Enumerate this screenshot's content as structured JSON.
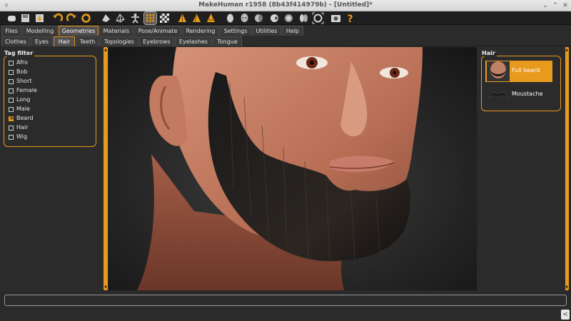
{
  "window": {
    "title": "MakeHuman r1958 (8b43f414979b) - [Untitled]*",
    "menu_glyph": "▿",
    "min_glyph": "⌄",
    "max_glyph": "⌃",
    "close_glyph": "✕"
  },
  "toolbar": {
    "icons": [
      "new-icon",
      "save-icon",
      "export-icon",
      "undo-icon",
      "redo-icon",
      "reset-icon",
      "smooth-icon",
      "wireframe-icon",
      "pose-icon",
      "grid-icon",
      "checker-icon",
      "front-view-icon",
      "side-view-icon",
      "top-view-icon",
      "head-icon",
      "skull-icon",
      "sphere-icon",
      "eye-icon",
      "torso-icon",
      "face-icon",
      "camera-icon",
      "frame-icon",
      "help-icon"
    ],
    "selected": "grid-icon"
  },
  "tabs_main": [
    "Files",
    "Modelling",
    "Geometries",
    "Materials",
    "Pose/Animate",
    "Rendering",
    "Settings",
    "Utilities",
    "Help"
  ],
  "tabs_main_active": "Geometries",
  "tabs_sub": [
    "Clothes",
    "Eyes",
    "Hair",
    "Teeth",
    "Topologies",
    "Eyebrows",
    "Eyelashes",
    "Tongue"
  ],
  "tabs_sub_active": "Hair",
  "tag_filter": {
    "title": "Tag filter",
    "items": [
      {
        "label": "Afro",
        "checked": false
      },
      {
        "label": "Bob",
        "checked": false
      },
      {
        "label": "Short",
        "checked": false
      },
      {
        "label": "Female",
        "checked": false
      },
      {
        "label": "Long",
        "checked": false
      },
      {
        "label": "Male",
        "checked": false
      },
      {
        "label": "Beard",
        "checked": true
      },
      {
        "label": "Hair",
        "checked": false
      },
      {
        "label": "Wig",
        "checked": false
      }
    ]
  },
  "hair_panel": {
    "title": "Hair",
    "items": [
      {
        "label": "Full beard",
        "selected": true
      },
      {
        "label": "Moustache",
        "selected": false
      }
    ]
  },
  "colors": {
    "accent": "#e89a1e",
    "background": "#2b2b2b",
    "toolbar": "#1f1f1f"
  },
  "status_input": {
    "value": ""
  },
  "corner_button": "<"
}
